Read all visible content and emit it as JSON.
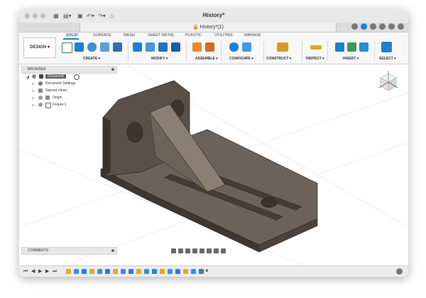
{
  "window": {
    "title": "History*"
  },
  "tab": {
    "title": "History*(1)"
  },
  "toolbar": {
    "workspace_button": "DESIGN ▾",
    "tabs": [
      {
        "label": "SOLID",
        "active": true
      },
      {
        "label": "SURFACE",
        "active": false
      },
      {
        "label": "MESH",
        "active": false
      },
      {
        "label": "SHEET METAL",
        "active": false
      },
      {
        "label": "PLASTIC",
        "active": false
      },
      {
        "label": "UTILITIES",
        "active": false
      },
      {
        "label": "MANAGE",
        "active": false
      }
    ],
    "groups": {
      "create": "CREATE ▾",
      "modify": "MODIFY ▾",
      "assemble": "ASSEMBLE ▾",
      "configure": "CONFIGURE ▾",
      "construct": "CONSTRUCT ▾",
      "inspect": "INSPECT ▾",
      "insert": "INSERT ▾",
      "select": "SELECT ▾"
    }
  },
  "browser": {
    "title": "BROWSER",
    "root": "(Unsaved)",
    "items": [
      {
        "label": "Document Settings",
        "icon": "gear-icon"
      },
      {
        "label": "Named Views",
        "icon": "folder-icon"
      },
      {
        "label": "Origin",
        "icon": "folder-icon"
      },
      {
        "label": "Fixture:1",
        "icon": "component-icon"
      }
    ]
  },
  "comments": {
    "title": "COMMENTS"
  },
  "colors": {
    "accent": "#1e7fd6",
    "part_dark": "#4a4038",
    "part_mid": "#6b6057",
    "part_light": "#85796f"
  }
}
